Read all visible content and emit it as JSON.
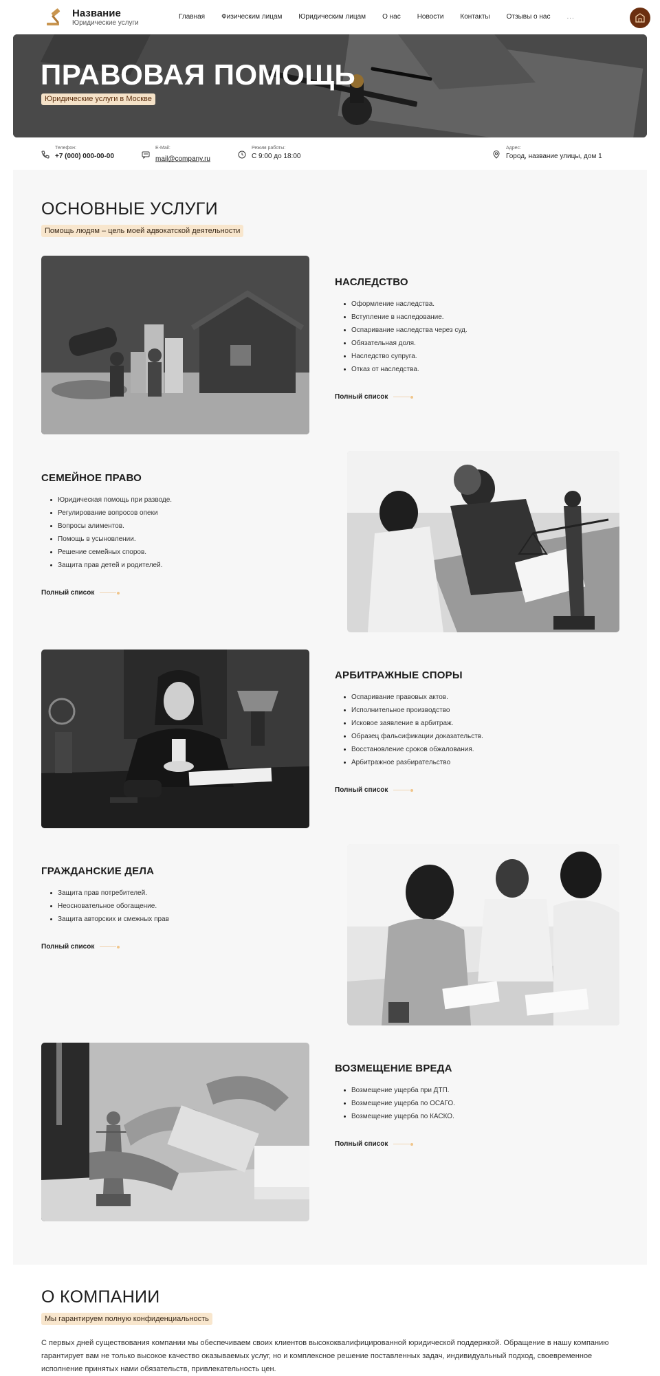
{
  "header": {
    "brand_title": "Название",
    "brand_subtitle": "Юридические услуги",
    "nav": [
      "Главная",
      "Физическим лицам",
      "Юридическим лицам",
      "О нас",
      "Новости",
      "Контакты",
      "Отзывы о нас",
      "..."
    ],
    "accent_color": "#6b2f10"
  },
  "hero": {
    "title": "ПРАВОВАЯ ПОМОЩЬ",
    "tag": "Юридические услуги в Москве"
  },
  "contacts": {
    "phone_label": "Телефон:",
    "phone": "+7 (000) 000-00-00",
    "email_label": "E-Mail:",
    "email": "mail@company.ru",
    "hours_label": "Режим работы:",
    "hours": "С 9:00 до 18:00",
    "address_label": "Адрес:",
    "address": "Город, название улицы, дом 1"
  },
  "services": {
    "title": "ОСНОВНЫЕ УСЛУГИ",
    "tag": "Помощь людям – цель моей адвокатской деятельности",
    "more_label": "Полный список",
    "items": [
      {
        "title": "НАСЛЕДСТВО",
        "image": "inheritance-photo",
        "list": [
          "Оформление наследства.",
          "Вступление в наследование.",
          "Оспаривание наследства через суд.",
          "Обязательная доля.",
          "Наследство супруга.",
          "Отказ от наследства."
        ]
      },
      {
        "title": "СЕМЕЙНОЕ ПРАВО",
        "image": "family-law-photo",
        "list": [
          "Юридическая помощь при разводе.",
          "Регулирование вопросов опеки",
          "Вопросы алиментов.",
          "Помощь в усыновлении.",
          "Решение семейных споров.",
          "Защита прав детей и родителей."
        ]
      },
      {
        "title": "АРБИТРАЖНЫЕ СПОРЫ",
        "image": "arbitration-photo",
        "list": [
          "Оспаривание правовых актов.",
          "Исполнительное производство",
          "Исковое заявление в арбитраж.",
          "Образец фальсификации доказательств.",
          "Восстановление сроков обжалования.",
          "Арбитражное разбирательство"
        ]
      },
      {
        "title": "ГРАЖДАНСКИЕ ДЕЛА",
        "image": "civil-cases-photo",
        "list": [
          "Защита прав потребителей.",
          "Неосновательное обогащение.",
          "Защита авторских и смежных прав"
        ]
      },
      {
        "title": "ВОЗМЕЩЕНИЕ ВРЕДА",
        "image": "damages-photo",
        "list": [
          "Возмещение ущерба при ДТП.",
          "Возмещение ущерба по ОСАГО.",
          "Возмещение ущерба по КАСКО."
        ]
      }
    ]
  },
  "about": {
    "title": "О КОМПАНИИ",
    "tag": "Мы гарантируем полную конфиденциальность",
    "text": "С первых дней существования компании мы обеспечиваем своих клиентов высококвалифицированной юридической поддержкой. Обращение в нашу компанию гарантирует вам не только высокое качество оказываемых услуг, но и комплексное решение поставленных задач, индивидуальный подход, своевременное исполнение принятых нами обязательств, привлекательность цен."
  }
}
